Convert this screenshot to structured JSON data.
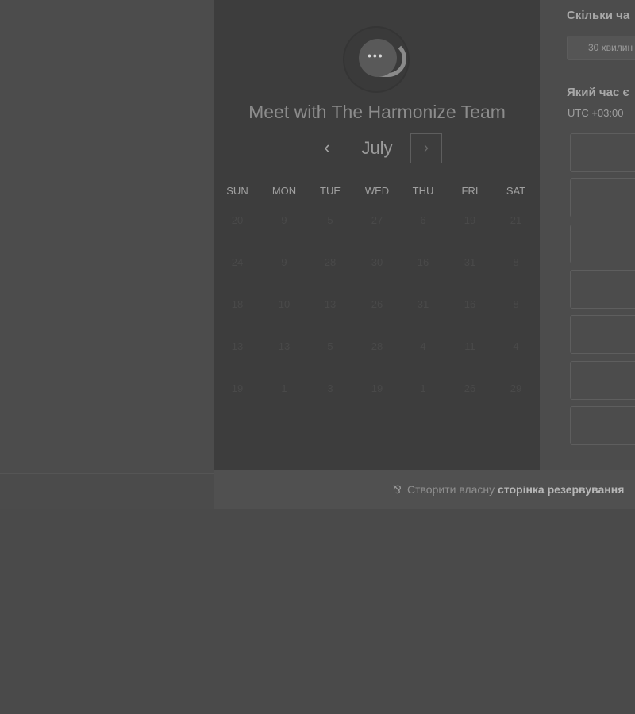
{
  "calendar": {
    "title": "Meet with The Harmonize Team",
    "month": "July",
    "prev_icon": "‹",
    "next_icon": "›",
    "weekdays": [
      "SUN",
      "MON",
      "TUE",
      "WED",
      "THU",
      "FRI",
      "SAT"
    ],
    "weeks": [
      [
        "20",
        "9",
        "5",
        "27",
        "6",
        "19",
        "21"
      ],
      [
        "24",
        "9",
        "28",
        "30",
        "16",
        "31",
        "8"
      ],
      [
        "18",
        "10",
        "13",
        "26",
        "31",
        "16",
        "8"
      ],
      [
        "13",
        "13",
        "5",
        "28",
        "4",
        "11",
        "4"
      ],
      [
        "19",
        "1",
        "3",
        "19",
        "1",
        "26",
        "29"
      ]
    ]
  },
  "booking": {
    "duration_question": "Скільки ча",
    "duration_option": "30 хвилин",
    "time_question": "Який час є",
    "timezone": "UTC +03:00",
    "slot_count": 7
  },
  "footer": {
    "prefix": "Створити власну ",
    "link": "сторінка резервування"
  },
  "colors": {
    "overlay": "#4a4a4a",
    "calendar_panel": "#3d3d3d"
  }
}
